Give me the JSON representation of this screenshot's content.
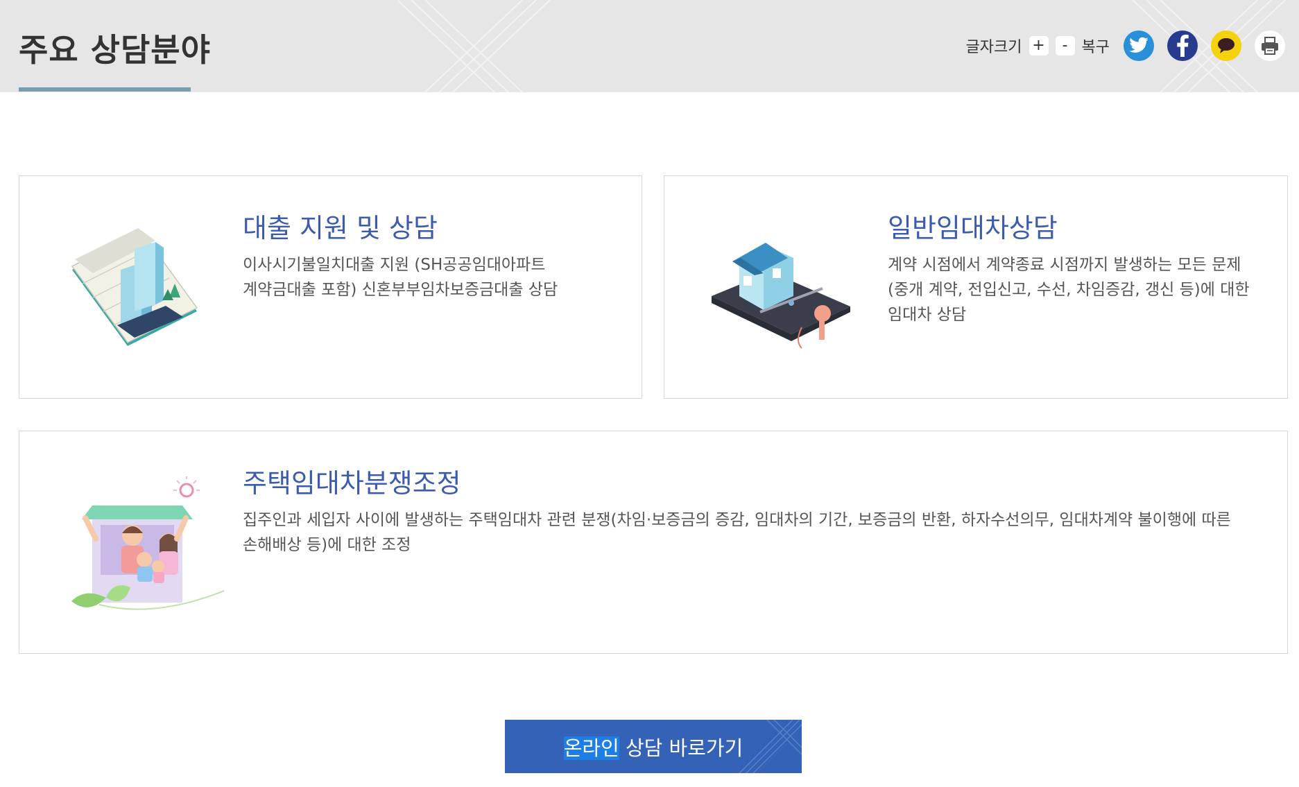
{
  "header": {
    "title": "주요 상담분야",
    "font_size_label": "글자크기",
    "increase_label": "+",
    "decrease_label": "-",
    "restore_label": "복구",
    "share": [
      {
        "icon": "twitter-icon",
        "color": "#2a8fd9"
      },
      {
        "icon": "facebook-icon",
        "color": "#283b8f"
      },
      {
        "icon": "kakaotalk-icon",
        "color": "#f5d20e"
      },
      {
        "icon": "print-icon",
        "color": "#ffffff"
      }
    ]
  },
  "cards": {
    "loan": {
      "title": "대출 지원 및 상담",
      "desc_line1": "이사시기불일치대출 지원 (SH공공임대아파트",
      "desc_line2": "계약금대출 포함) 신혼부부임차보증금대출 상담"
    },
    "lease": {
      "title": "일반임대차상담",
      "desc_line1": "계약 시점에서 계약종료 시점까지 발생하는 모든 문제",
      "desc_line2": "(중개 계약, 전입신고, 수선, 차임증감, 갱신 등)에 대한",
      "desc_line3": "임대차 상담"
    },
    "dispute": {
      "title": "주택임대차분쟁조정",
      "desc_line1": "집주인과 세입자 사이에 발생하는 주택임대차 관련 분쟁(차임·보증금의 증감, 임대차의 기간, 보증금의 반환, 하자수선의무, 임대차계약 불이행에 따른",
      "desc_line2": "손해배상 등)에 대한 조정"
    }
  },
  "cta": {
    "label_highlight": "온라인",
    "label_rest": " 상담 바로가기"
  },
  "colors": {
    "accent": "#3462b6",
    "card_title": "#3a5bb0",
    "header_bg": "#e6e6e6"
  }
}
